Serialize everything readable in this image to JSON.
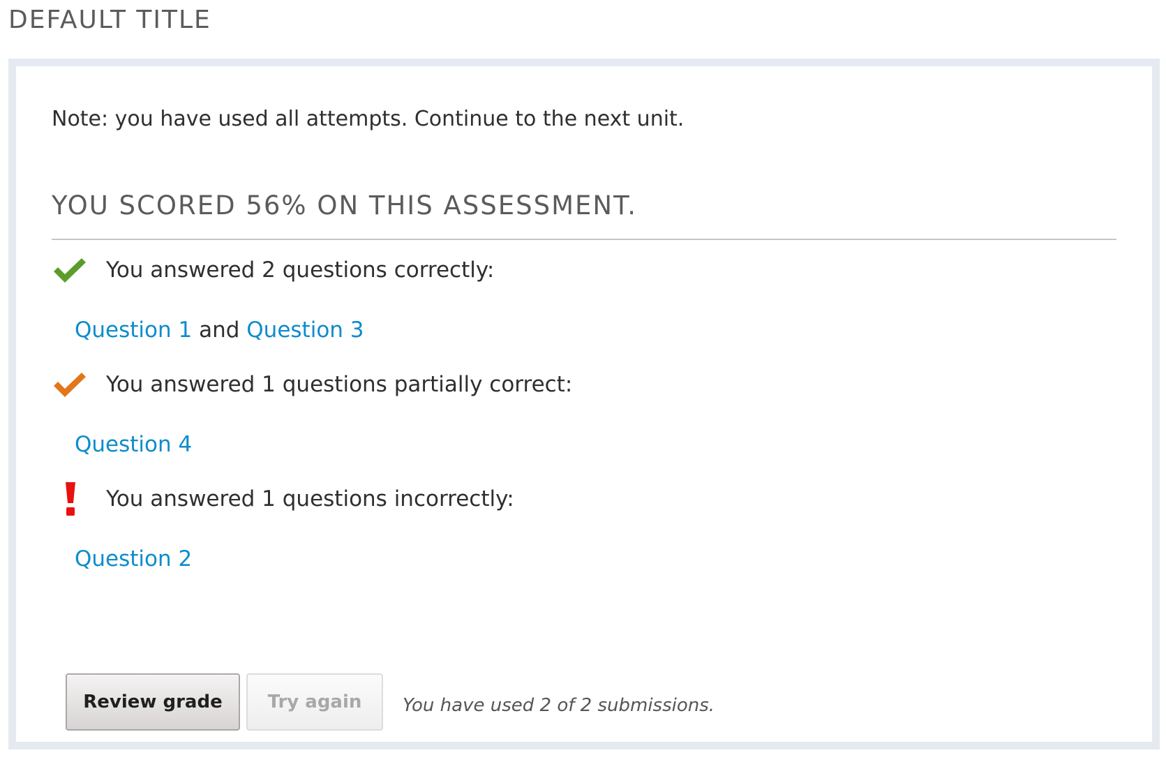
{
  "page": {
    "title": "DEFAULT TITLE"
  },
  "assessment": {
    "note": "Note: you have used all attempts. Continue to the next unit.",
    "score_heading": "YOU SCORED 56% ON THIS ASSESSMENT.",
    "results": [
      {
        "status": "correct",
        "icon": "checkmark-icon",
        "color": "#5b9c2a",
        "text": "You answered 2 questions correctly:",
        "questions": [
          "Question 1",
          "Question 3"
        ],
        "joiner": "and"
      },
      {
        "status": "partial",
        "icon": "checkmark-icon",
        "color": "#e2761a",
        "text": "You answered 1 questions partially correct:",
        "questions": [
          "Question 4"
        ]
      },
      {
        "status": "incorrect",
        "icon": "exclamation-icon",
        "color": "#e8110f",
        "text": "You answered 1 questions incorrectly:",
        "questions": [
          "Question 2"
        ]
      }
    ],
    "actions": {
      "review_label": "Review grade",
      "retry_label": "Try again",
      "retry_disabled": true,
      "submission_note": "You have used 2 of 2 submissions."
    }
  },
  "colors": {
    "link": "#0e8ccc",
    "panel_border": "#e4eaef",
    "heading": "#5b5b5b"
  }
}
